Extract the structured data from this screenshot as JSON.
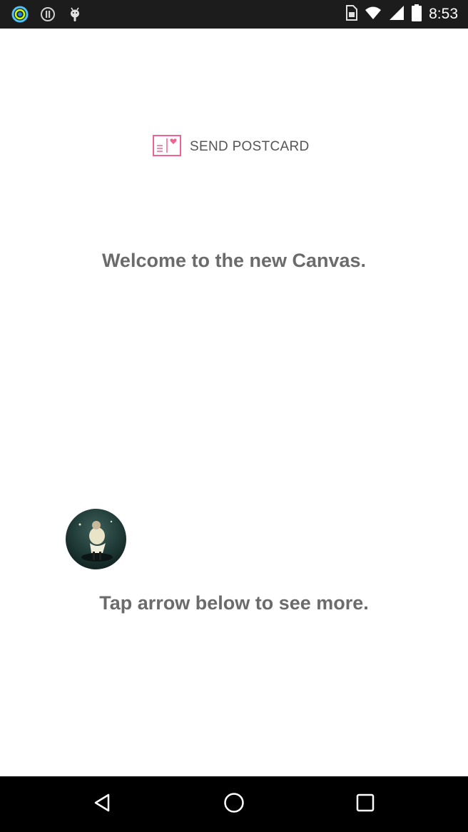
{
  "status_bar": {
    "time": "8:53",
    "left_icons": [
      "ring-app-icon",
      "info-icon",
      "android-debug-icon"
    ],
    "right_icons": [
      "sim-icon",
      "wifi-icon",
      "signal-icon",
      "battery-icon"
    ]
  },
  "main": {
    "postcard_button": {
      "label": "SEND POSTCARD",
      "icon": "postcard-icon",
      "accent_color": "#f06292"
    },
    "welcome_text": "Welcome to the new Canvas.",
    "avatar": {
      "icon": "avatar"
    },
    "hint_text": "Tap arrow below to see more."
  },
  "nav_bar": {
    "buttons": [
      "back-icon",
      "home-icon",
      "recents-icon"
    ]
  },
  "colors": {
    "text": "#6b6b6b",
    "status_bar": "#1c1c1c",
    "nav_bar": "#000000",
    "background": "#ffffff"
  }
}
